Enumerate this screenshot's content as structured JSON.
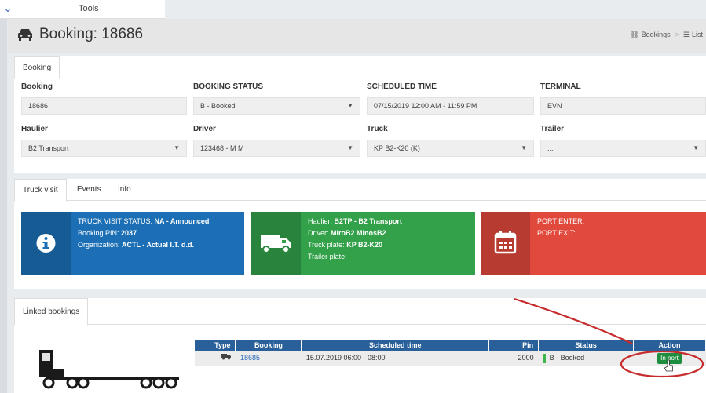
{
  "topbar": {
    "tools_label": "Tools"
  },
  "header": {
    "title": "Booking: 18686",
    "breadcrumbs": [
      "Bookings",
      "List"
    ]
  },
  "booking_panel": {
    "tab_label": "Booking",
    "fields": {
      "booking": {
        "label": "Booking",
        "value": "18686"
      },
      "booking_status": {
        "label": "BOOKING STATUS",
        "value": "B - Booked"
      },
      "scheduled_time": {
        "label": "SCHEDULED TIME",
        "value": "07/15/2019 12:00 AM - 11:59 PM"
      },
      "terminal": {
        "label": "TERMINAL",
        "value": "EVN"
      },
      "haulier": {
        "label": "Haulier",
        "value": "B2 Transport"
      },
      "driver": {
        "label": "Driver",
        "value": "123468 - M M"
      },
      "truck": {
        "label": "Truck",
        "value": "KP B2-K20 (K)"
      },
      "trailer": {
        "label": "Trailer",
        "value": "..."
      }
    }
  },
  "visit_panel": {
    "tabs": [
      "Truck visit",
      "Events",
      "Info"
    ],
    "cards": {
      "status": {
        "line1_label": "TRUCK VISIT STATUS:",
        "line1_value": "NA - Announced",
        "line2_label": "Booking PIN:",
        "line2_value": "2037",
        "line3_label": "Organization:",
        "line3_value": "ACTL - Actual I.T. d.d."
      },
      "transport": {
        "line1_label": "Haulier:",
        "line1_value": "B2TP - B2 Transport",
        "line2_label": "Driver:",
        "line2_value": "MiroB2 MinosB2",
        "line3_label": "Truck plate:",
        "line3_value": "KP B2-K20",
        "line4_label": "Trailer plate:"
      },
      "port": {
        "line1_label": "PORT ENTER:",
        "line2_label": "PORT EXIT:"
      }
    },
    "colors": {
      "blue": "#1c6fb4",
      "green": "#33a04a",
      "red": "#e0493c"
    }
  },
  "linked_panel": {
    "tab_label": "Linked bookings",
    "columns": [
      "Type",
      "Booking",
      "Scheduled time",
      "Pin",
      "Status",
      "Action"
    ],
    "rows": [
      {
        "type_icon": "truck-icon",
        "booking": "18685",
        "scheduled_time": "15.07.2019 06:00 - 08:00",
        "pin": "2000",
        "status": "B - Booked",
        "action": "In port"
      }
    ]
  }
}
